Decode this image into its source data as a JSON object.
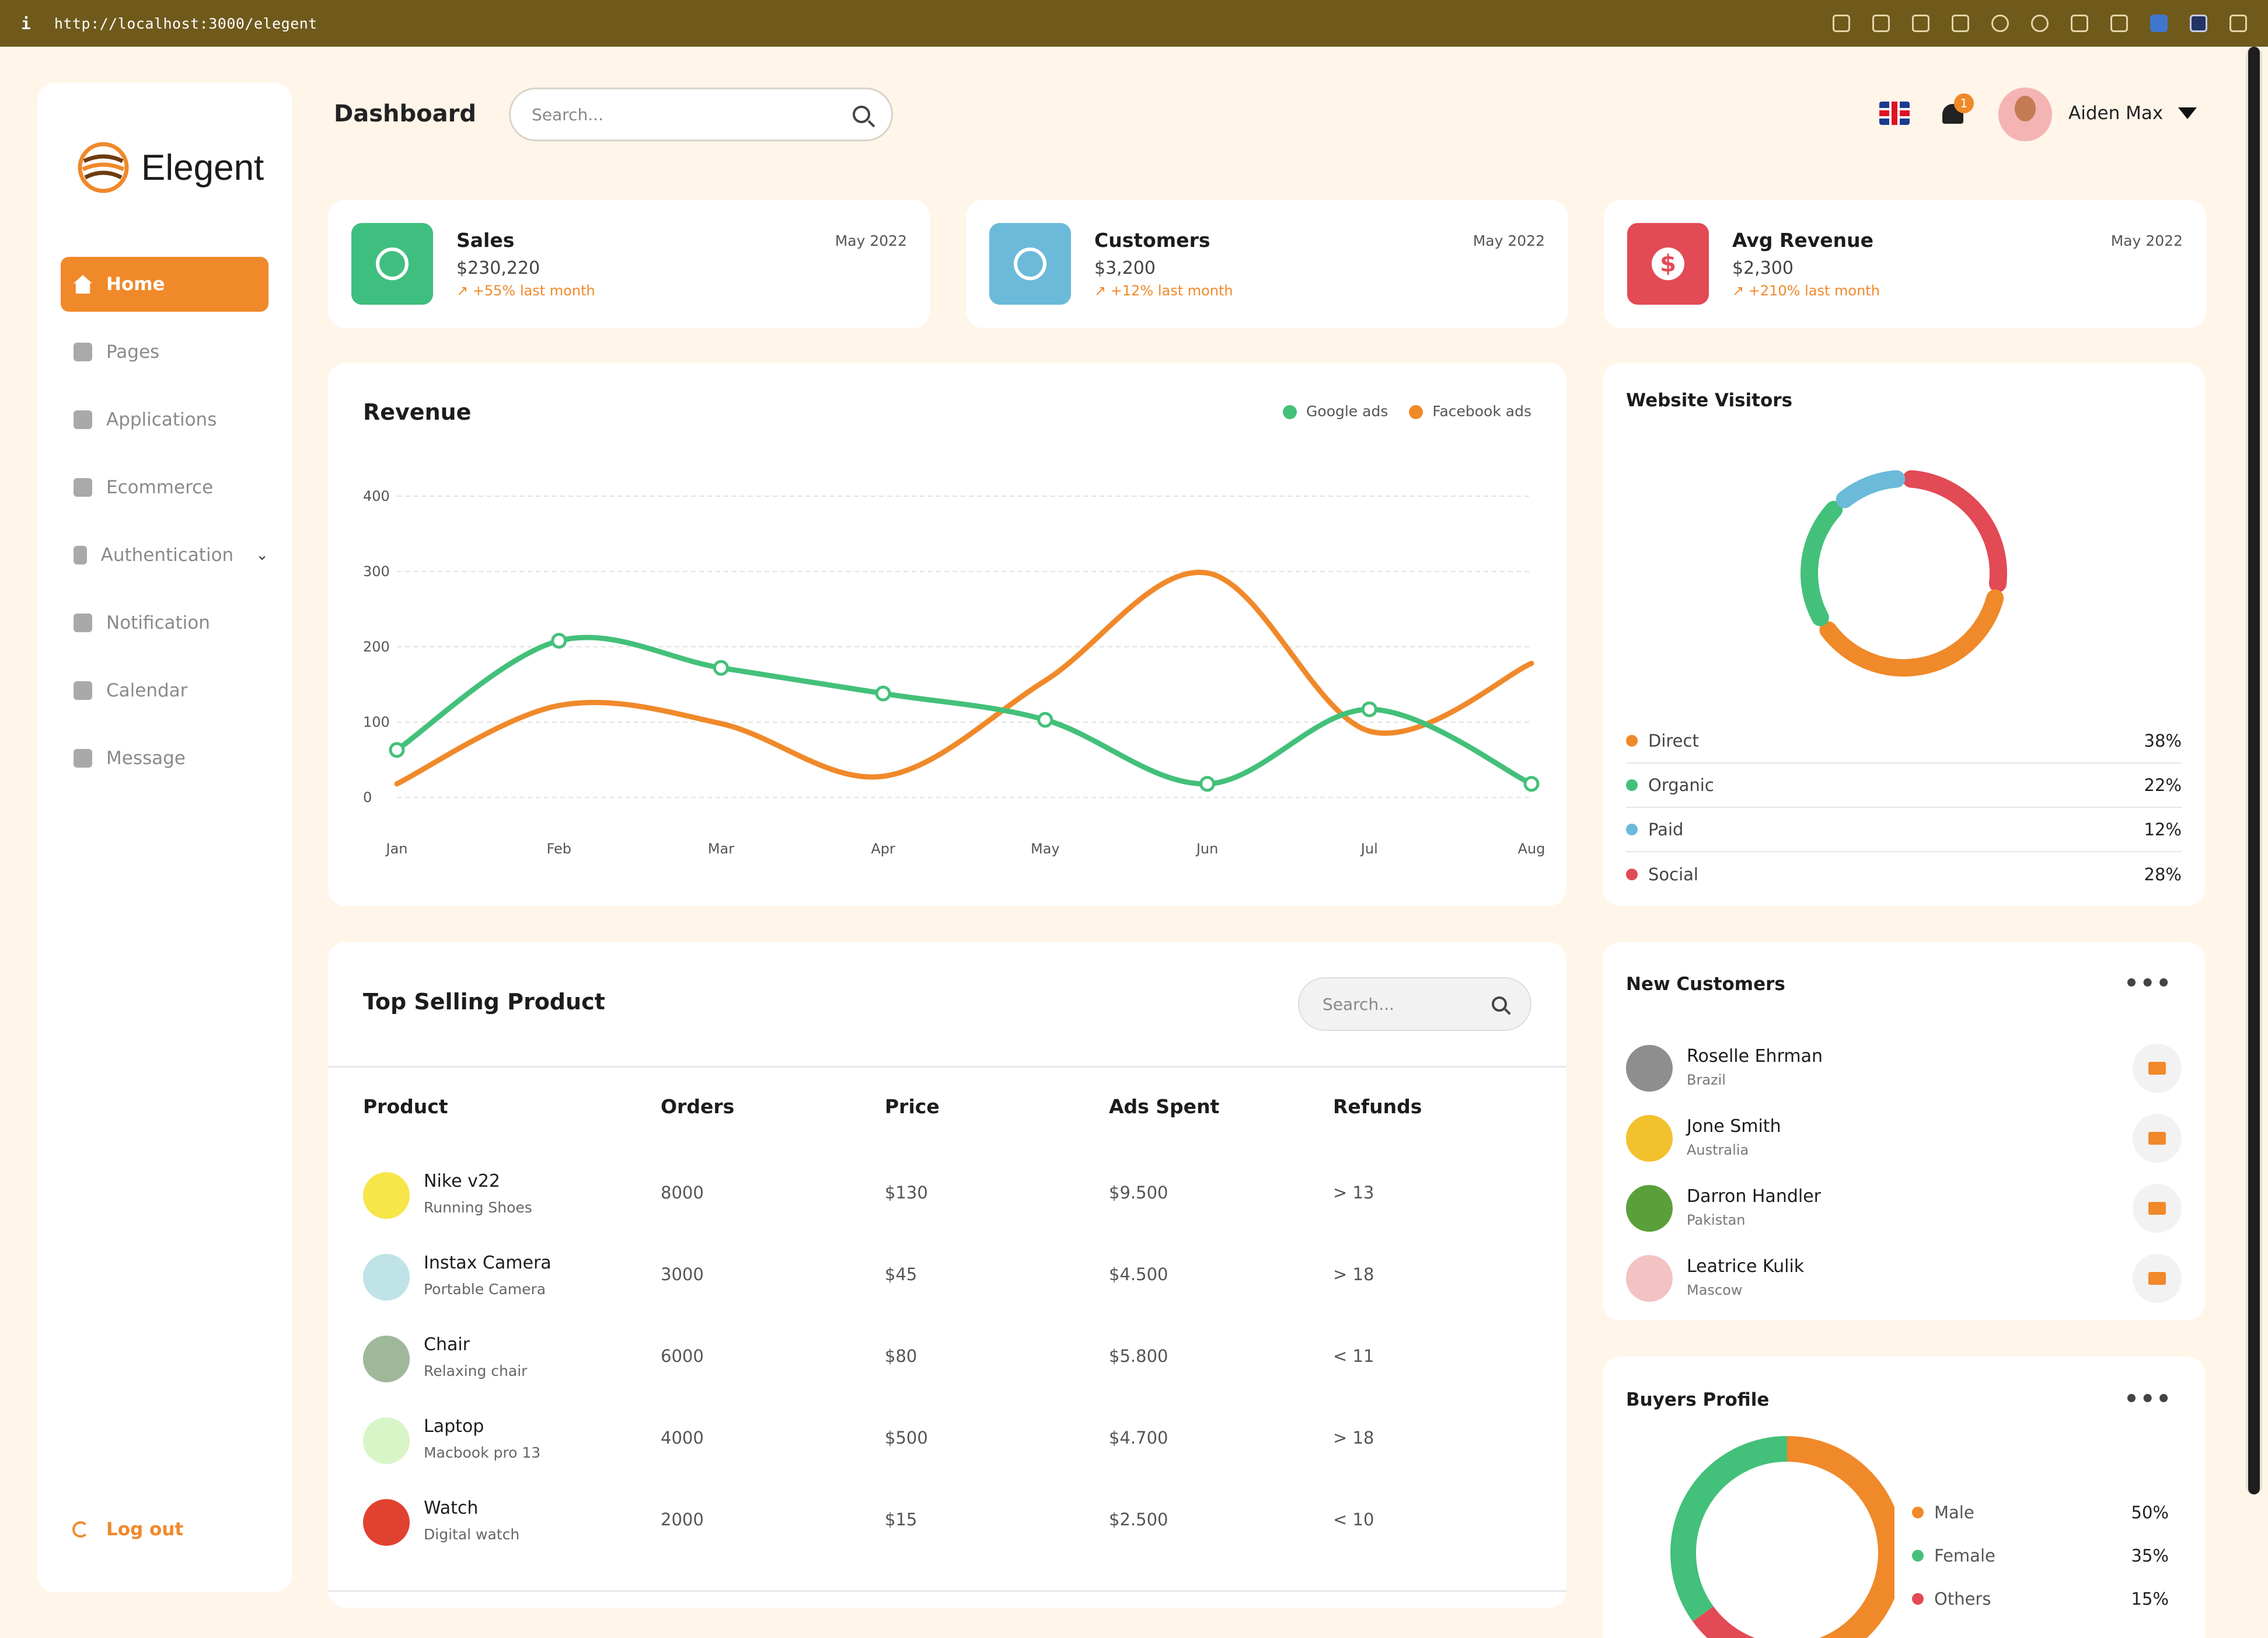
{
  "browser": {
    "url": "http://localhost:3000/elegent",
    "info": "i"
  },
  "brand": {
    "name": "Elegent",
    "accent": "#f0892a"
  },
  "sidebar": {
    "items": [
      {
        "label": "Home",
        "icon": "home-icon",
        "active": true
      },
      {
        "label": "Pages",
        "icon": "pages-icon"
      },
      {
        "label": "Applications",
        "icon": "grid-icon"
      },
      {
        "label": "Ecommerce",
        "icon": "bag-icon"
      },
      {
        "label": "Authentication",
        "icon": "shield-icon",
        "expandable": true
      },
      {
        "label": "Notification",
        "icon": "bell-icon"
      },
      {
        "label": "Calendar",
        "icon": "calendar-icon"
      },
      {
        "label": "Message",
        "icon": "chat-icon"
      }
    ],
    "logout": "Log out"
  },
  "header": {
    "title": "Dashboard",
    "search_placeholder": "Search...",
    "notifications": "1",
    "user": "Aiden Max"
  },
  "stats": [
    {
      "title": "Sales",
      "value": "$230,220",
      "trend": "+55% last month",
      "date": "May 2022",
      "color": "#3fbf7f",
      "icon": "price-tag-icon"
    },
    {
      "title": "Customers",
      "value": "$3,200",
      "trend": "+12% last month",
      "date": "May 2022",
      "color": "#6bbad9",
      "icon": "customer-icon"
    },
    {
      "title": "Avg Revenue",
      "value": "$2,300",
      "trend": "+210% last month",
      "date": "May 2022",
      "color": "#e24a55",
      "icon": "dollar-icon",
      "glyph": "$"
    }
  ],
  "chart_data": {
    "type": "line",
    "title": "Revenue",
    "categories": [
      "Jan",
      "Feb",
      "Mar",
      "Apr",
      "May",
      "Jun",
      "Jul",
      "Aug"
    ],
    "yticks": [
      0,
      100,
      200,
      300,
      400
    ],
    "ylim": [
      0,
      400
    ],
    "grid": true,
    "legend_position": "top-right",
    "series": [
      {
        "name": "Google ads",
        "color": "#43c07a",
        "values": [
          63,
          208,
          172,
          138,
          103,
          18,
          117,
          18
        ]
      },
      {
        "name": "Facebook ads",
        "color": "#f0892a",
        "values": [
          18,
          122,
          98,
          28,
          155,
          298,
          88,
          178
        ]
      }
    ]
  },
  "visitors": {
    "title": "Website Visitors",
    "items": [
      {
        "label": "Direct",
        "pct": "38%",
        "value": 38,
        "color": "#f0892a"
      },
      {
        "label": "Organic",
        "pct": "22%",
        "value": 22,
        "color": "#43c07a"
      },
      {
        "label": "Paid",
        "pct": "12%",
        "value": 12,
        "color": "#6bbad9"
      },
      {
        "label": "Social",
        "pct": "28%",
        "value": 28,
        "color": "#e24a55"
      }
    ]
  },
  "products": {
    "title": "Top Selling Product",
    "search_placeholder": "Search...",
    "headers": [
      "Product",
      "Orders",
      "Price",
      "Ads Spent",
      "Refunds"
    ],
    "rows": [
      {
        "name": "Nike v22",
        "sub": "Running Shoes",
        "orders": "8000",
        "price": "$130",
        "ads": "$9.500",
        "refunds": "> 13",
        "color": "#f7e64a"
      },
      {
        "name": "Instax Camera",
        "sub": "Portable Camera",
        "orders": "3000",
        "price": "$45",
        "ads": "$4.500",
        "refunds": "> 18",
        "color": "#bfe3e6"
      },
      {
        "name": "Chair",
        "sub": "Relaxing chair",
        "orders": "6000",
        "price": "$80",
        "ads": "$5.800",
        "refunds": "< 11",
        "color": "#9fb89a"
      },
      {
        "name": "Laptop",
        "sub": "Macbook pro 13",
        "orders": "4000",
        "price": "$500",
        "ads": "$4.700",
        "refunds": "> 18",
        "color": "#d8f5c8"
      },
      {
        "name": "Watch",
        "sub": "Digital watch",
        "orders": "2000",
        "price": "$15",
        "ads": "$2.500",
        "refunds": "< 10",
        "color": "#e0422f"
      }
    ]
  },
  "customers": {
    "title": "New Customers",
    "items": [
      {
        "name": "Roselle Ehrman",
        "location": "Brazil",
        "color": "#8e8e8e"
      },
      {
        "name": "Jone Smith",
        "location": "Australia",
        "color": "#f2c12e"
      },
      {
        "name": "Darron Handler",
        "location": "Pakistan",
        "color": "#5aa03a"
      },
      {
        "name": "Leatrice Kulik",
        "location": "Mascow",
        "color": "#f3c2c2"
      }
    ]
  },
  "buyers": {
    "title": "Buyers Profile",
    "items": [
      {
        "label": "Male",
        "pct": "50%",
        "value": 50,
        "color": "#f0892a"
      },
      {
        "label": "Female",
        "pct": "35%",
        "value": 35,
        "color": "#43c07a"
      },
      {
        "label": "Others",
        "pct": "15%",
        "value": 15,
        "color": "#e24a55"
      }
    ]
  }
}
